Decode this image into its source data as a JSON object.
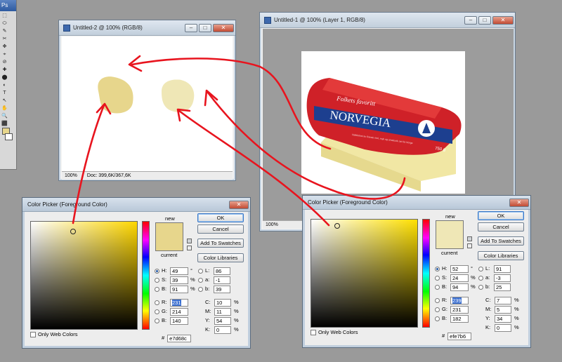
{
  "toolbox": {
    "app_label": "Ps",
    "tools": [
      "⬚",
      "⬭",
      "✎",
      "✂",
      "✥",
      "⌖",
      "⊘",
      "✚",
      "⬤",
      "◐",
      "T",
      "↖",
      "✋",
      "🔍",
      "⬛",
      "⬜"
    ]
  },
  "doc2": {
    "title": "Untitled-2 @ 100% (RGB/8)",
    "zoom": "100%",
    "doc_info": "Doc: 399,6K/367,6K",
    "swatch_left": "#e7d68c",
    "swatch_right": "#efe7b6"
  },
  "doc1": {
    "title": "Untitled-1 @ 100% (Layer 1, RGB/8)",
    "zoom": "100%"
  },
  "window_buttons": {
    "minimize": "–",
    "maximize": "□",
    "close": "✕"
  },
  "cheese": {
    "tagline": "Folkets favoritt",
    "brand": "NORVEGIA",
    "weight": "750 g",
    "detail_text": "Nøkkelost av fineste mel, myk og smaksrik ost fra Norge"
  },
  "picker_left": {
    "title": "Color Picker (Foreground Color)",
    "ok": "OK",
    "cancel": "Cancel",
    "add_swatches": "Add To Swatches",
    "color_libraries": "Color Libraries",
    "new_label": "new",
    "current_label": "current",
    "new_color": "#e7d68c",
    "current_color": "#e7d68c",
    "H": "49",
    "S": "39",
    "B": "91",
    "R": "231",
    "G": "214",
    "Bv": "140",
    "L": "86",
    "a": "-1",
    "b": "39",
    "C": "10",
    "M": "11",
    "Y": "54",
    "K": "0",
    "hex": "e7d68c",
    "hue_color": "#ffd700",
    "deg": "°",
    "pct": "%",
    "hash": "#",
    "web_only": "Only Web Colors"
  },
  "picker_right": {
    "title": "Color Picker (Foreground Color)",
    "ok": "OK",
    "cancel": "Cancel",
    "add_swatches": "Add To Swatches",
    "color_libraries": "Color Libraries",
    "new_label": "new",
    "current_label": "current",
    "new_color": "#efe7b6",
    "current_color": "#efe7b6",
    "H": "52",
    "S": "24",
    "B": "94",
    "R": "239",
    "G": "231",
    "Bv": "182",
    "L": "91",
    "a": "-3",
    "b": "25",
    "C": "7",
    "M": "5",
    "Y": "34",
    "K": "0",
    "hex": "efe7b6",
    "hue_color": "#ffe000",
    "deg": "°",
    "pct": "%",
    "hash": "#",
    "web_only": "Only Web Colors"
  },
  "annotation_color": "#e8141e"
}
